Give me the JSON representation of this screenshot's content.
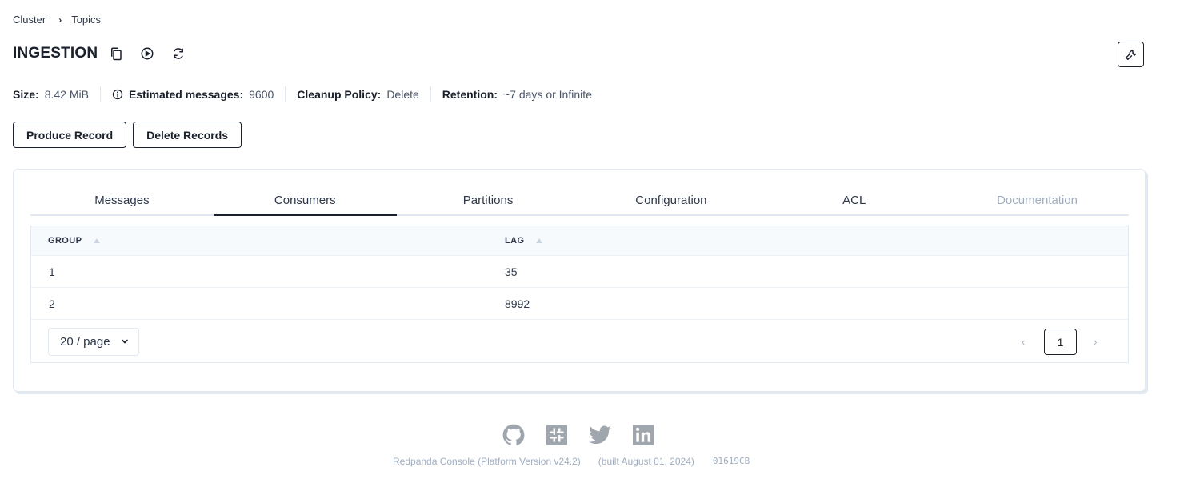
{
  "breadcrumb": {
    "cluster": "Cluster",
    "separator": "›",
    "topics": "Topics"
  },
  "header": {
    "title": "INGESTION"
  },
  "stats": {
    "size_label": "Size:",
    "size_value": "8.42 MiB",
    "estimated_label": "Estimated messages:",
    "estimated_value": "9600",
    "cleanup_label": "Cleanup Policy:",
    "cleanup_value": "Delete",
    "retention_label": "Retention:",
    "retention_value": "~7 days or Infinite"
  },
  "actions": {
    "produce": "Produce Record",
    "delete": "Delete Records"
  },
  "tabs": [
    {
      "label": "Messages",
      "active": false,
      "disabled": false
    },
    {
      "label": "Consumers",
      "active": true,
      "disabled": false
    },
    {
      "label": "Partitions",
      "active": false,
      "disabled": false
    },
    {
      "label": "Configuration",
      "active": false,
      "disabled": false
    },
    {
      "label": "ACL",
      "active": false,
      "disabled": false
    },
    {
      "label": "Documentation",
      "active": false,
      "disabled": true
    }
  ],
  "table": {
    "headers": [
      "GROUP",
      "LAG"
    ],
    "rows": [
      [
        "1",
        "35"
      ],
      [
        "2",
        "8992"
      ]
    ]
  },
  "pagination": {
    "page_size": "20 / page",
    "current_page": "1",
    "prev": "‹",
    "next": "›"
  },
  "footer": {
    "icons": [
      "github-icon",
      "slack-icon",
      "twitter-icon",
      "linkedin-icon"
    ],
    "version": "Redpanda Console (Platform Version v24.2)",
    "built": "(built August 01, 2024)",
    "hash": "01619CB"
  },
  "colors": {
    "text": "#1a202c",
    "muted": "#a0aec0",
    "border": "#e2e8f0",
    "icon_gray": "#a0a6ad"
  }
}
